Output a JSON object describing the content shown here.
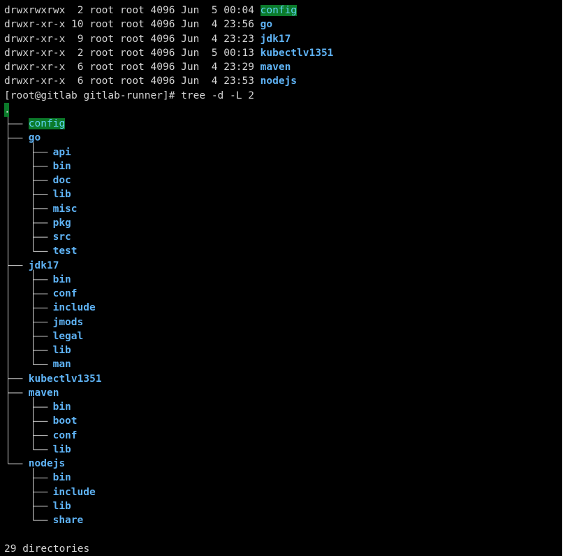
{
  "listing": [
    {
      "perms": "drwxrwxrwx",
      "links": " 2",
      "owner": "root",
      "group": "root",
      "size": "4096",
      "month": "Jun",
      "day": " 5",
      "time": "00:04",
      "name": "config",
      "highlight": true
    },
    {
      "perms": "drwxr-xr-x",
      "links": "10",
      "owner": "root",
      "group": "root",
      "size": "4096",
      "month": "Jun",
      "day": " 4",
      "time": "23:56",
      "name": "go",
      "highlight": false
    },
    {
      "perms": "drwxr-xr-x",
      "links": " 9",
      "owner": "root",
      "group": "root",
      "size": "4096",
      "month": "Jun",
      "day": " 4",
      "time": "23:23",
      "name": "jdk17",
      "highlight": false
    },
    {
      "perms": "drwxr-xr-x",
      "links": " 2",
      "owner": "root",
      "group": "root",
      "size": "4096",
      "month": "Jun",
      "day": " 5",
      "time": "00:13",
      "name": "kubectlv1351",
      "highlight": false
    },
    {
      "perms": "drwxr-xr-x",
      "links": " 6",
      "owner": "root",
      "group": "root",
      "size": "4096",
      "month": "Jun",
      "day": " 4",
      "time": "23:29",
      "name": "maven",
      "highlight": false
    },
    {
      "perms": "drwxr-xr-x",
      "links": " 6",
      "owner": "root",
      "group": "root",
      "size": "4096",
      "month": "Jun",
      "day": " 4",
      "time": "23:53",
      "name": "nodejs",
      "highlight": false
    }
  ],
  "prompt": "[root@gitlab gitlab-runner]# ",
  "command": "tree -d -L 2",
  "tree_root": ".",
  "tree": [
    {
      "name": "config",
      "highlight": true,
      "children": []
    },
    {
      "name": "go",
      "highlight": false,
      "children": [
        "api",
        "bin",
        "doc",
        "lib",
        "misc",
        "pkg",
        "src",
        "test"
      ]
    },
    {
      "name": "jdk17",
      "highlight": false,
      "children": [
        "bin",
        "conf",
        "include",
        "jmods",
        "legal",
        "lib",
        "man"
      ]
    },
    {
      "name": "kubectlv1351",
      "highlight": false,
      "children": []
    },
    {
      "name": "maven",
      "highlight": false,
      "children": [
        "bin",
        "boot",
        "conf",
        "lib"
      ]
    },
    {
      "name": "nodejs",
      "highlight": false,
      "children": [
        "bin",
        "include",
        "lib",
        "share"
      ]
    }
  ],
  "summary": "29 directories",
  "colors": {
    "background": "#000000",
    "text": "#d3d3d3",
    "directory": "#5fb3f5",
    "highlight_bg": "#0b7a2a"
  }
}
